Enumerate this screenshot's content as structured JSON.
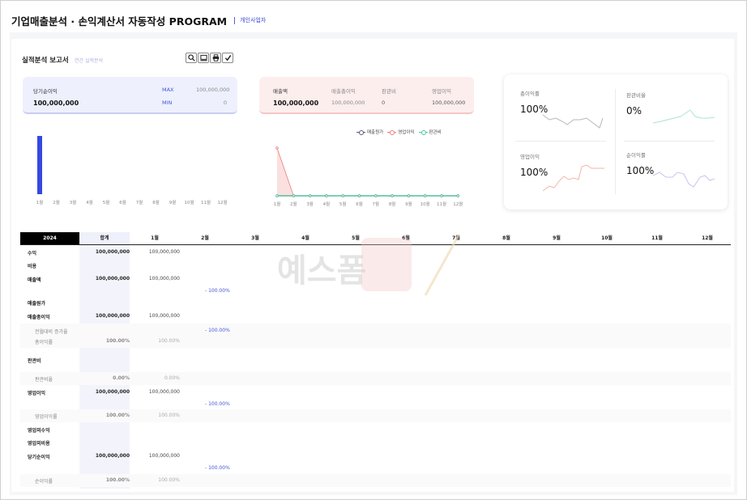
{
  "header": {
    "title": "기업매출분석 · 손익계산서 자동작성 PROGRAM",
    "subtitle": "개인사업자"
  },
  "report": {
    "title": "실적분석 보고서",
    "subtitle": "연간 실적분석"
  },
  "toolbar": {
    "icons": [
      "search-icon",
      "monitor-icon",
      "print-icon",
      "check-icon"
    ]
  },
  "kpi_net": {
    "label": "당기순이익",
    "value": "100,000,000",
    "max_label": "MAX",
    "max_value": "100,000,000",
    "min_label": "MIN",
    "min_value": "0"
  },
  "kpi_sales": {
    "label": "매출액",
    "value": "100,000,000",
    "cols": [
      {
        "label": "매출총이익",
        "value": "100,000,000"
      },
      {
        "label": "판관비",
        "value": "0"
      },
      {
        "label": "영업이익",
        "value": "100,000,000"
      }
    ]
  },
  "ratios": [
    {
      "label": "총이익률",
      "value": "100%"
    },
    {
      "label": "판관비율",
      "value": "0%"
    },
    {
      "label": "영업이익",
      "value": "100%"
    },
    {
      "label": "순이익률",
      "value": "100%"
    }
  ],
  "months": [
    "1월",
    "2월",
    "3월",
    "4월",
    "5월",
    "6월",
    "7월",
    "8월",
    "9월",
    "10월",
    "11월",
    "12월"
  ],
  "chart_data": [
    {
      "type": "bar",
      "categories": [
        "1월",
        "2월",
        "3월",
        "4월",
        "5월",
        "6월",
        "7월",
        "8월",
        "9월",
        "10월",
        "11월",
        "12월"
      ],
      "values": [
        100000000,
        0,
        0,
        0,
        0,
        0,
        0,
        0,
        0,
        0,
        0,
        0
      ],
      "color": "#3448e0",
      "ylim": [
        0,
        100000000
      ]
    },
    {
      "type": "line",
      "categories": [
        "1월",
        "2월",
        "3월",
        "4월",
        "5월",
        "6월",
        "7월",
        "8월",
        "9월",
        "10월",
        "11월",
        "12월"
      ],
      "series": [
        {
          "name": "매출원가",
          "values": [
            0,
            0,
            0,
            0,
            0,
            0,
            0,
            0,
            0,
            0,
            0,
            0
          ],
          "color": "#555a7a"
        },
        {
          "name": "영업이익",
          "values": [
            100000000,
            0,
            0,
            0,
            0,
            0,
            0,
            0,
            0,
            0,
            0,
            0
          ],
          "color": "#f07a7a"
        },
        {
          "name": "판관비",
          "values": [
            0,
            0,
            0,
            0,
            0,
            0,
            0,
            0,
            0,
            0,
            0,
            0
          ],
          "color": "#49c9a0"
        }
      ],
      "legend": "top-right",
      "ylim": [
        0,
        100000000
      ]
    }
  ],
  "table": {
    "year": "2024",
    "total_label": "합계",
    "rows": [
      {
        "label": "수익",
        "type": "head",
        "total": "100,000,000",
        "m1": "100,000,000"
      },
      {
        "label": "비용",
        "type": "head",
        "total": "",
        "m1": ""
      },
      {
        "label": "매출액",
        "type": "head",
        "total": "100,000,000",
        "m1": "100,000,000",
        "pct": "- 100.00%"
      },
      {
        "label": "매출원가",
        "type": "head",
        "total": "",
        "m1": ""
      },
      {
        "label": "매출총이익",
        "type": "head",
        "total": "100,000,000",
        "m1": "100,000,000"
      },
      {
        "label": "전월대비 증가율",
        "type": "sub",
        "total": "",
        "m1": "",
        "pct": "- 100.00%"
      },
      {
        "label": "총이익률",
        "type": "sub",
        "total": "100.00%",
        "m1": "100.00%"
      },
      {
        "label": "판관비",
        "type": "head",
        "total": "",
        "m1": ""
      },
      {
        "label": "판관비율",
        "type": "sub",
        "total": "0.00%",
        "m1": "0.00%"
      },
      {
        "label": "영업이익",
        "type": "head",
        "total": "100,000,000",
        "m1": "100,000,000",
        "pct": "- 100.00%"
      },
      {
        "label": "영업이익률",
        "type": "sub",
        "total": "100.00%",
        "m1": "100.00%"
      },
      {
        "label": "영업외수익",
        "type": "head",
        "total": "",
        "m1": ""
      },
      {
        "label": "영업외비용",
        "type": "head",
        "total": "",
        "m1": ""
      },
      {
        "label": "당기순이익",
        "type": "head",
        "total": "100,000,000",
        "m1": "100,000,000",
        "pct": "- 100.00%"
      },
      {
        "label": "순이익률",
        "type": "sub",
        "total": "100.00%",
        "m1": "100.00%"
      }
    ]
  },
  "watermark": {
    "text": "예스폼"
  }
}
